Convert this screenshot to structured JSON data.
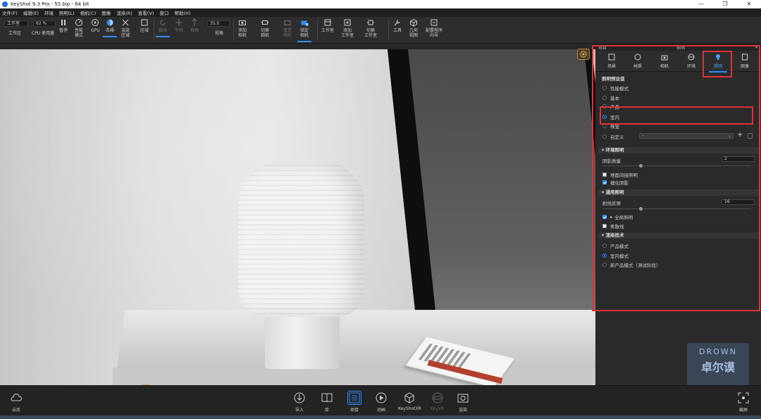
{
  "titlebar": {
    "title": "KeyShot 9.3 Pro  - 55.bip  - 64 bit"
  },
  "menu": [
    "文件(F)",
    "编辑(E)",
    "环境",
    "照明(L)",
    "相机(C)",
    "图像",
    "渲染(R)",
    "查看(V)",
    "窗口",
    "帮助(H)"
  ],
  "toolbar": {
    "workspace_select": "工作室",
    "workspace_label": "工作区",
    "cpu_value": "62 %",
    "cpu_label": "CPU 使用量",
    "pause": "暂停",
    "perf_mode": "性能\n模式",
    "gpu": "GPU",
    "denoise": "去噪",
    "render_region": "渲染\n区域",
    "region": "区域",
    "rotate": "翻译",
    "pan": "平移",
    "dolly": "推移",
    "fov_value": "35.0",
    "fov": "视角",
    "add_camera": "添加\n相机",
    "switch_camera": "切换\n相机",
    "reset_camera": "重置\n相机",
    "lock_camera": "锁定\n相机",
    "studio": "工作室",
    "add_studio": "添加\n工作室",
    "switch_studio": "切换\n工作室",
    "tools": "工具",
    "geometry_view": "几何\n视图",
    "config_program": "配置程序\n向导"
  },
  "panel": {
    "header_left": "项目",
    "header_center": "照明",
    "tabs": [
      "场景",
      "材质",
      "相机",
      "环境",
      "照明",
      "图像"
    ],
    "active_tab": 4,
    "preset_title": "照明预设值",
    "presets": [
      "性能模式",
      "基本",
      "产品",
      "室内",
      "珠宝",
      "自定义"
    ],
    "selected_preset": 3,
    "custom_dropdown": "-",
    "env_section": "环境照明",
    "shadow_quality_label": "阴影质量",
    "shadow_quality_value": "2",
    "ground_gi": "地面间接照明",
    "ground_gi_checked": false,
    "detail_shadow": "细化阴影",
    "detail_shadow_checked": true,
    "general_section": "通用照明",
    "ray_bounce_label": "射线反弹",
    "ray_bounce_value": "16",
    "global_illumination": "全局照明",
    "global_illumination_checked": true,
    "caustics": "焦散线",
    "caustics_checked": false,
    "render_tech_section": "渲染技术",
    "render_techniques": [
      "产品模式",
      "室内模式",
      "新产品模式（测试阶段）"
    ],
    "selected_technique": 1
  },
  "watermark": {
    "en": "DROWN",
    "zh": "卓尔谟"
  },
  "bottom": {
    "cloud": "云库",
    "import": "导入",
    "library": "库",
    "project": "项目",
    "animation": "动画",
    "keyshotxr": "KeyShotXR",
    "keyvr": "KeyVR",
    "render": "渲染",
    "screenshot": "截屏"
  },
  "colors": {
    "accent": "#2f8cff",
    "highlight_box": "#e0303a",
    "panel_bg": "#2a2a2a"
  }
}
